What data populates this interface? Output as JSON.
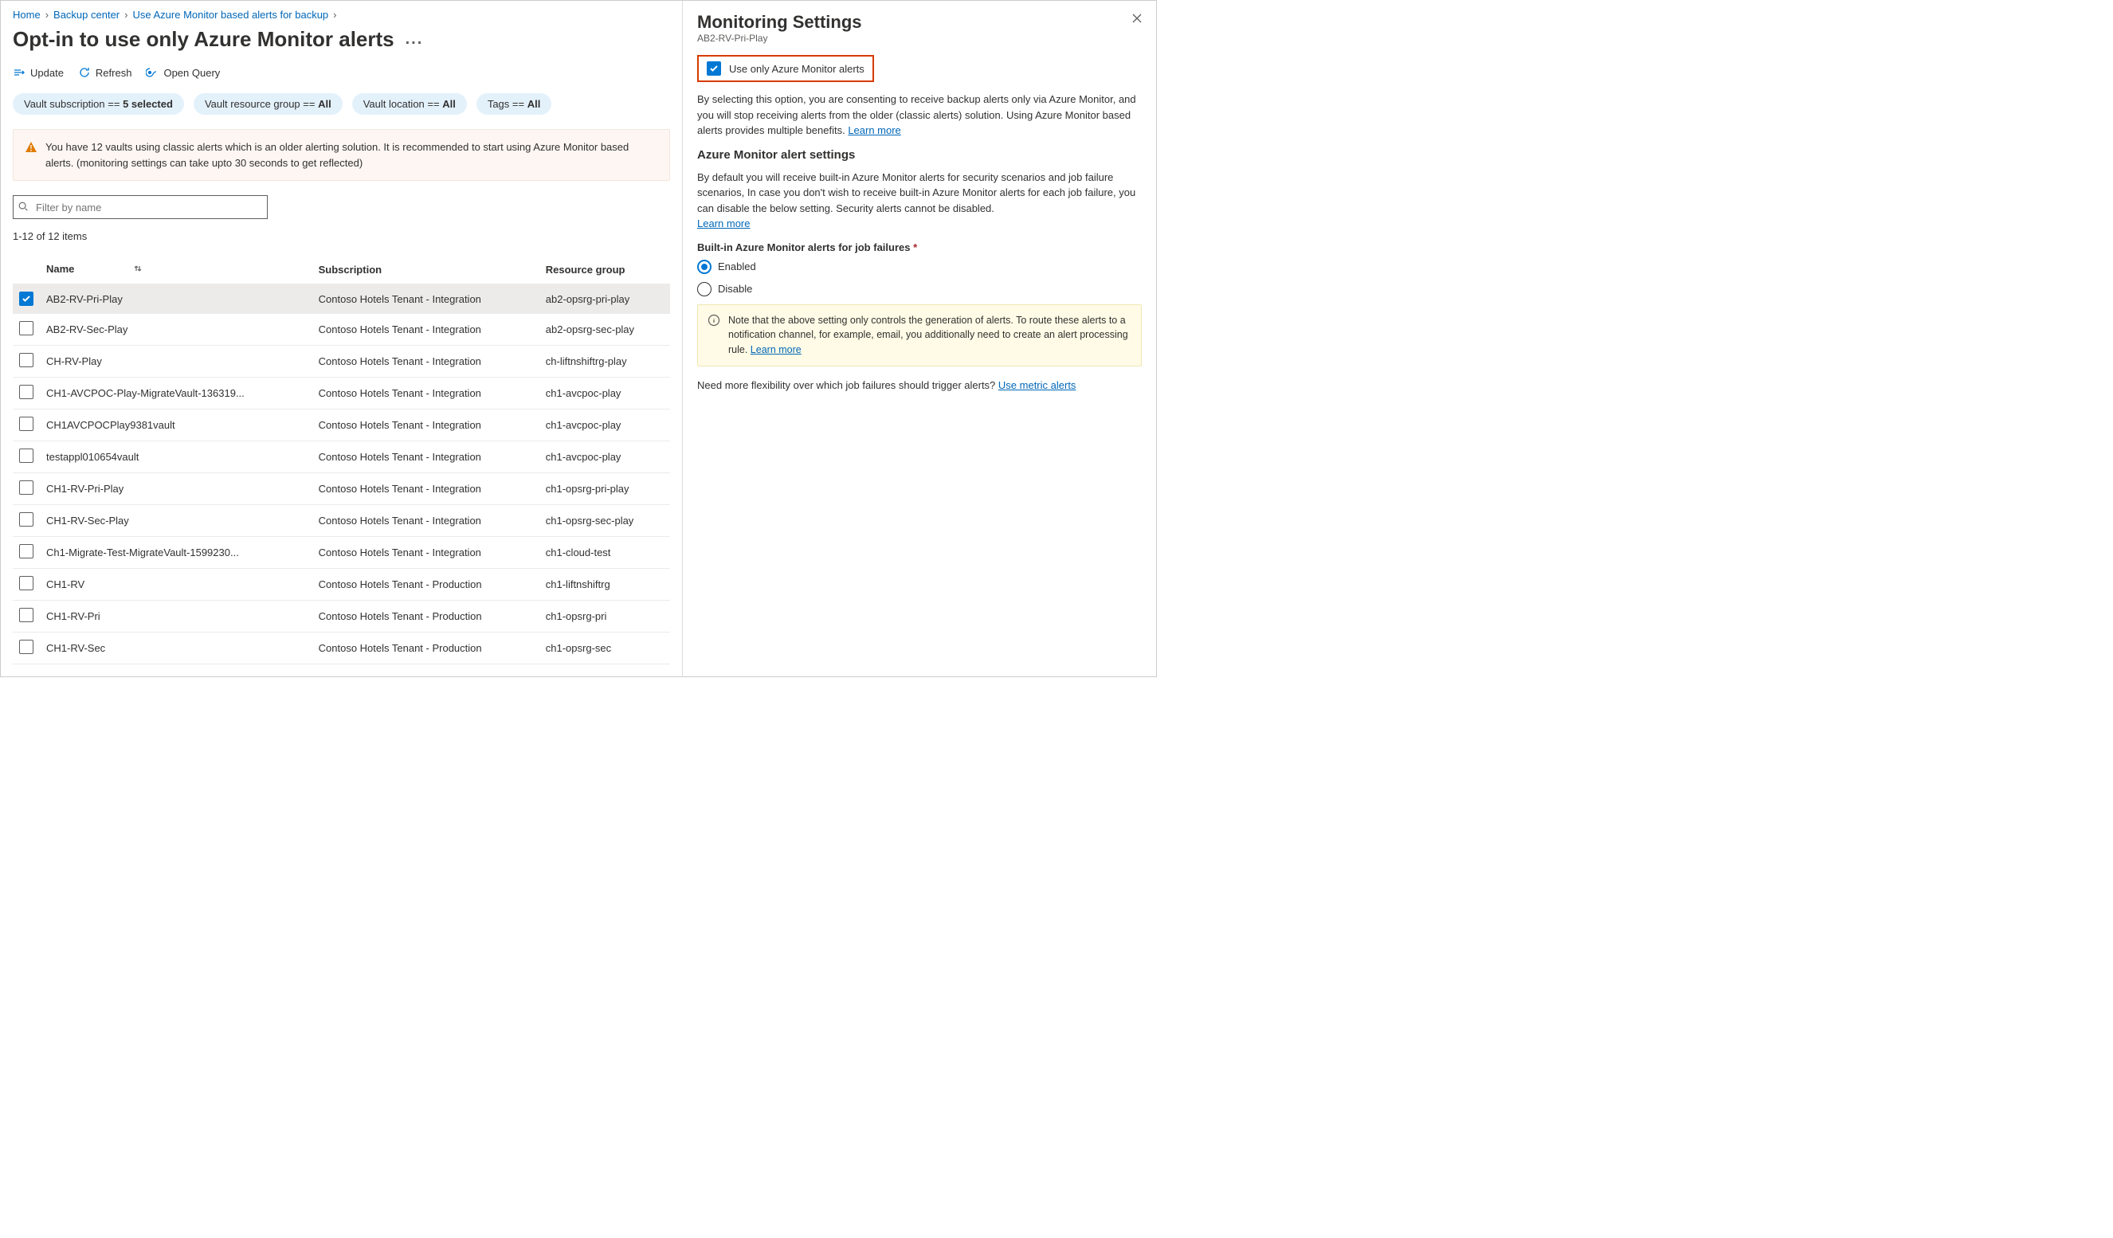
{
  "breadcrumbs": {
    "items": [
      {
        "label": "Home",
        "link": true
      },
      {
        "label": "Backup center",
        "link": true
      },
      {
        "label": "Use Azure Monitor based alerts for backup",
        "link": true
      }
    ]
  },
  "page": {
    "title": "Opt-in to use only Azure Monitor alerts",
    "more_label": "..."
  },
  "actions": {
    "update": "Update",
    "refresh": "Refresh",
    "open_query": "Open Query"
  },
  "filters": {
    "subscription_prefix": "Vault subscription == ",
    "subscription_value": "5 selected",
    "rg_prefix": "Vault resource group == ",
    "rg_value": "All",
    "location_prefix": "Vault location == ",
    "location_value": "All",
    "tags_prefix": "Tags == ",
    "tags_value": "All"
  },
  "warning": {
    "text": "You have 12 vaults using classic alerts which is an older alerting solution. It is recommended to start using Azure Monitor based alerts. (monitoring settings can take upto 30 seconds to get reflected)"
  },
  "filter_input": {
    "placeholder": "Filter by name"
  },
  "count_label": "1-12 of 12 items",
  "table": {
    "headers": {
      "name": "Name",
      "subscription": "Subscription",
      "rg": "Resource group"
    },
    "rows": [
      {
        "checked": true,
        "name": "AB2-RV-Pri-Play",
        "subscription": "Contoso Hotels Tenant - Integration",
        "rg": "ab2-opsrg-pri-play"
      },
      {
        "checked": false,
        "name": "AB2-RV-Sec-Play",
        "subscription": "Contoso Hotels Tenant - Integration",
        "rg": "ab2-opsrg-sec-play"
      },
      {
        "checked": false,
        "name": "CH-RV-Play",
        "subscription": "Contoso Hotels Tenant - Integration",
        "rg": "ch-liftnshiftrg-play"
      },
      {
        "checked": false,
        "name": "CH1-AVCPOC-Play-MigrateVault-136319...",
        "subscription": "Contoso Hotels Tenant - Integration",
        "rg": "ch1-avcpoc-play"
      },
      {
        "checked": false,
        "name": "CH1AVCPOCPlay9381vault",
        "subscription": "Contoso Hotels Tenant - Integration",
        "rg": "ch1-avcpoc-play"
      },
      {
        "checked": false,
        "name": "testappl010654vault",
        "subscription": "Contoso Hotels Tenant - Integration",
        "rg": "ch1-avcpoc-play"
      },
      {
        "checked": false,
        "name": "CH1-RV-Pri-Play",
        "subscription": "Contoso Hotels Tenant - Integration",
        "rg": "ch1-opsrg-pri-play"
      },
      {
        "checked": false,
        "name": "CH1-RV-Sec-Play",
        "subscription": "Contoso Hotels Tenant - Integration",
        "rg": "ch1-opsrg-sec-play"
      },
      {
        "checked": false,
        "name": "Ch1-Migrate-Test-MigrateVault-1599230...",
        "subscription": "Contoso Hotels Tenant - Integration",
        "rg": "ch1-cloud-test"
      },
      {
        "checked": false,
        "name": "CH1-RV",
        "subscription": "Contoso Hotels Tenant - Production",
        "rg": "ch1-liftnshiftrg"
      },
      {
        "checked": false,
        "name": "CH1-RV-Pri",
        "subscription": "Contoso Hotels Tenant - Production",
        "rg": "ch1-opsrg-pri"
      },
      {
        "checked": false,
        "name": "CH1-RV-Sec",
        "subscription": "Contoso Hotels Tenant - Production",
        "rg": "ch1-opsrg-sec"
      }
    ]
  },
  "side": {
    "title": "Monitoring Settings",
    "subtitle": "AB2-RV-Pri-Play",
    "checkbox_label": "Use only Azure Monitor alerts",
    "checkbox_checked": true,
    "desc1": "By selecting this option, you are consenting to receive backup alerts only via Azure Monitor, and you will stop receiving alerts from the older (classic alerts) solution. Using Azure Monitor based alerts provides multiple benefits. ",
    "learn_more1": "Learn more",
    "section_heading": "Azure Monitor alert settings",
    "desc2": "By default you will receive built-in Azure Monitor alerts for security scenarios and job failure scenarios, In case you don't wish to receive built-in Azure Monitor alerts for each job failure, you can disable the below setting. Security alerts cannot be disabled. ",
    "learn_more2": "Learn more",
    "field_label": "Built-in Azure Monitor alerts for job failures",
    "radio_enabled": "Enabled",
    "radio_disable": "Disable",
    "radio_selected": "enabled",
    "info_text": "Note that the above setting only controls the generation of alerts. To route these alerts to a notification channel, for example, email, you additionally need to create an alert processing rule.  ",
    "info_link": "Learn more",
    "flex_text": "Need more flexibility over which job failures should trigger alerts? ",
    "flex_link": "Use metric alerts"
  }
}
